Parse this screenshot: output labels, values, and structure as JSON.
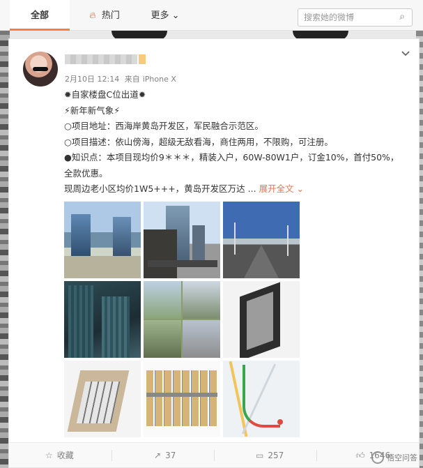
{
  "topnav": {
    "tabs": [
      {
        "label": "全部",
        "active": true
      },
      {
        "label": "热门",
        "icon": "flame-icon"
      },
      {
        "label": "更多",
        "icon": "chevron-down-icon"
      }
    ],
    "search": {
      "placeholder": "搜索她的微博",
      "icon": "search-icon"
    }
  },
  "post": {
    "meta": {
      "date": "2月10日 12:14",
      "source_prefix": "来自",
      "source": "iPhone X"
    },
    "content": {
      "line1": "✹自家楼盘C位出道✹",
      "line2": "⚡新年新气象⚡",
      "line3": "○项目地址：西海岸黄岛开发区，军民融合示范区。",
      "line4": "○项目描述：依山傍海，超级无敌看海，商住两用，不限购，可注册。",
      "line5": "●知识点：本项目现均价9＊＊＊，精装入户，60W-80W1户，订金10%，首付50%，全款优惠。",
      "line6": "现周边老小区均价1W5+++，黄岛开发区万达 ...",
      "expand": "展开全文 ⌄"
    },
    "actions": {
      "favorite": "收藏",
      "repost": "37",
      "comment": "257",
      "like": "1646"
    }
  },
  "watermark": "悟空问答",
  "colors": {
    "accent": "#fa7d3c",
    "link": "#eb7350"
  }
}
